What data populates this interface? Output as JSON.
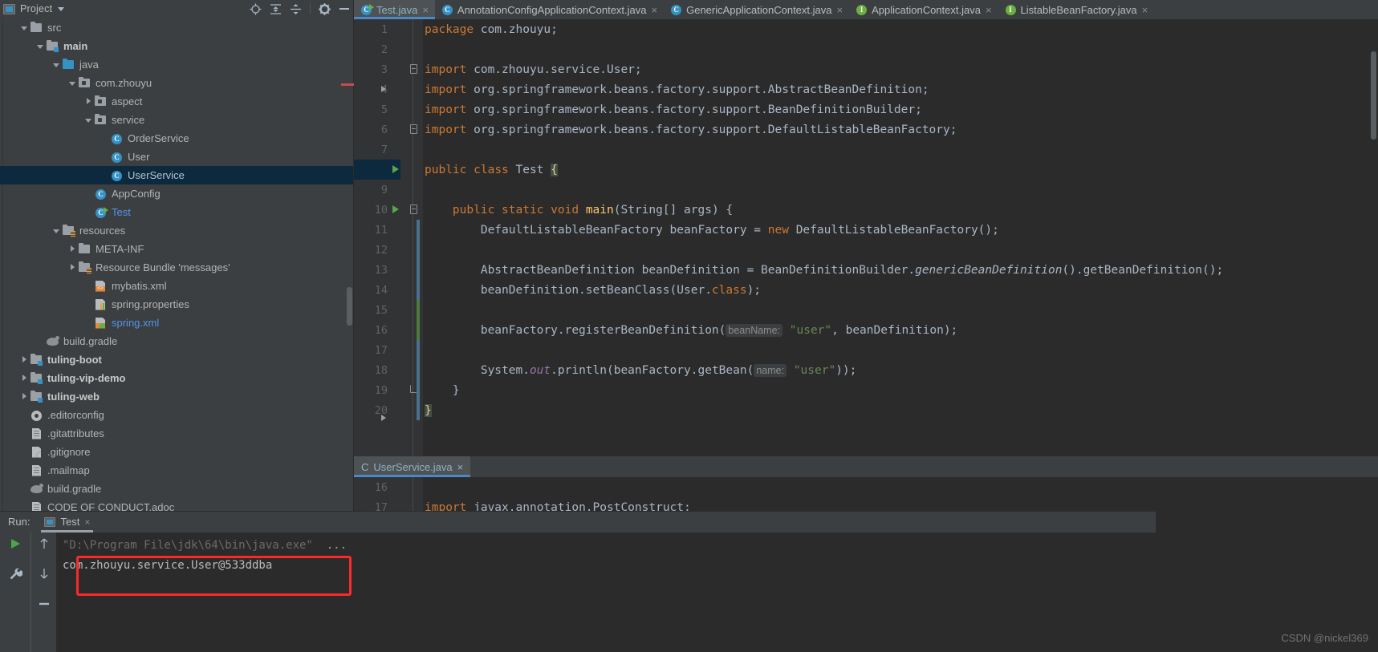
{
  "sidebar": {
    "title": "Project",
    "icons": [
      "locate-icon",
      "expand-all-icon",
      "collapse-all-icon",
      "gear-icon",
      "minimize-icon"
    ],
    "tree": [
      {
        "label": "src",
        "indent": 1,
        "arrow": "open",
        "icon": "folder-grey",
        "style": "plain"
      },
      {
        "label": "main",
        "indent": 2,
        "arrow": "open",
        "icon": "folder-module",
        "style": "bold"
      },
      {
        "label": "java",
        "indent": 3,
        "arrow": "open",
        "icon": "folder-blue",
        "style": "plain"
      },
      {
        "label": "com.zhouyu",
        "indent": 4,
        "arrow": "open",
        "icon": "folder-pkg",
        "style": "plain"
      },
      {
        "label": "aspect",
        "indent": 5,
        "arrow": "closed",
        "icon": "folder-pkg",
        "style": "plain"
      },
      {
        "label": "service",
        "indent": 5,
        "arrow": "open",
        "icon": "folder-pkg",
        "style": "plain"
      },
      {
        "label": "OrderService",
        "indent": 6,
        "arrow": "none",
        "icon": "class-icon",
        "style": "plain"
      },
      {
        "label": "User",
        "indent": 6,
        "arrow": "none",
        "icon": "class-icon",
        "style": "plain"
      },
      {
        "label": "UserService",
        "indent": 6,
        "arrow": "none",
        "icon": "class-icon",
        "style": "selected"
      },
      {
        "label": "AppConfig",
        "indent": 5,
        "arrow": "none",
        "icon": "class-icon",
        "style": "plain"
      },
      {
        "label": "Test",
        "indent": 5,
        "arrow": "none",
        "icon": "class-runnable",
        "style": "blue"
      },
      {
        "label": "resources",
        "indent": 3,
        "arrow": "open",
        "icon": "folder-res",
        "style": "plain"
      },
      {
        "label": "META-INF",
        "indent": 4,
        "arrow": "closed",
        "icon": "folder-grey",
        "style": "plain"
      },
      {
        "label": "Resource Bundle 'messages'",
        "indent": 4,
        "arrow": "closed",
        "icon": "folder-bundle",
        "style": "plain"
      },
      {
        "label": "mybatis.xml",
        "indent": 5,
        "arrow": "none",
        "icon": "xml-file",
        "style": "plain"
      },
      {
        "label": "spring.properties",
        "indent": 5,
        "arrow": "none",
        "icon": "properties-file",
        "style": "plain"
      },
      {
        "label": "spring.xml",
        "indent": 5,
        "arrow": "none",
        "icon": "spring-xml-file",
        "style": "blue"
      },
      {
        "label": "build.gradle",
        "indent": 2,
        "arrow": "none",
        "icon": "gradle-file",
        "style": "plain"
      },
      {
        "label": "tuling-boot",
        "indent": 1,
        "arrow": "closed",
        "icon": "folder-module",
        "style": "bold"
      },
      {
        "label": "tuling-vip-demo",
        "indent": 1,
        "arrow": "closed",
        "icon": "folder-module",
        "style": "bold"
      },
      {
        "label": "tuling-web",
        "indent": 1,
        "arrow": "closed",
        "icon": "folder-module",
        "style": "bold"
      },
      {
        "label": ".editorconfig",
        "indent": 1,
        "arrow": "none",
        "icon": "gear-file",
        "style": "plain"
      },
      {
        "label": ".gitattributes",
        "indent": 1,
        "arrow": "none",
        "icon": "doc-file",
        "style": "plain"
      },
      {
        "label": ".gitignore",
        "indent": 1,
        "arrow": "none",
        "icon": "gitignore-file",
        "style": "plain"
      },
      {
        "label": ".mailmap",
        "indent": 1,
        "arrow": "none",
        "icon": "doc-file",
        "style": "plain"
      },
      {
        "label": "build.gradle",
        "indent": 1,
        "arrow": "none",
        "icon": "gradle-file",
        "style": "plain"
      },
      {
        "label": "CODE OF CONDUCT.adoc",
        "indent": 1,
        "arrow": "none",
        "icon": "doc-file",
        "style": "plain"
      }
    ]
  },
  "editor": {
    "tabs": [
      {
        "label": "Test.java",
        "icon": "class-runnable-icon",
        "active": true,
        "close": "×"
      },
      {
        "label": "AnnotationConfigApplicationContext.java",
        "icon": "class-icon",
        "active": false,
        "close": "×"
      },
      {
        "label": "GenericApplicationContext.java",
        "icon": "class-icon",
        "active": false,
        "close": "×"
      },
      {
        "label": "ApplicationContext.java",
        "icon": "interface-icon",
        "active": false,
        "close": "×"
      },
      {
        "label": "ListableBeanFactory.java",
        "icon": "interface-icon",
        "active": false,
        "close": "×"
      }
    ],
    "lines": [
      {
        "n": "1",
        "html": "<span class=\"kw\">package</span> com.zhouyu;"
      },
      {
        "n": "2",
        "html": ""
      },
      {
        "n": "3",
        "html": "<span class=\"kw\">import</span> com.zhouyu.service.User;"
      },
      {
        "n": "4",
        "html": "<span class=\"kw\">import</span> org.springframework.beans.factory.support.AbstractBeanDefinition;"
      },
      {
        "n": "5",
        "html": "<span class=\"kw\">import</span> org.springframework.beans.factory.support.BeanDefinitionBuilder;"
      },
      {
        "n": "6",
        "html": "<span class=\"kw\">import</span> org.springframework.beans.factory.support.DefaultListableBeanFactory;"
      },
      {
        "n": "7",
        "html": ""
      },
      {
        "n": "8",
        "html": "<span class=\"kw\">public</span> <span class=\"kw\">class</span> Test <span class=\"brace-hl\">{</span>"
      },
      {
        "n": "9",
        "html": ""
      },
      {
        "n": "10",
        "html": "    <span class=\"kw\">public</span> <span class=\"kw\">static</span> <span class=\"kw\">void</span> <span class=\"mtd\">main</span>(String[] args) {"
      },
      {
        "n": "11",
        "html": "        DefaultListableBeanFactory beanFactory = <span class=\"kw\">new</span> DefaultListableBeanFactory();"
      },
      {
        "n": "12",
        "html": ""
      },
      {
        "n": "13",
        "html": "        AbstractBeanDefinition beanDefinition = BeanDefinitionBuilder.<span class=\"ital\">genericBeanDefinition</span>().getBeanDefinition();"
      },
      {
        "n": "14",
        "html": "        beanDefinition.setBeanClass(User.<span class=\"kw\">class</span>);"
      },
      {
        "n": "15",
        "html": ""
      },
      {
        "n": "16",
        "html": "        beanFactory.registerBeanDefinition(<span class=\"hintp\">beanName:</span> <span class=\"str\">\"user\"</span>, beanDefinition);"
      },
      {
        "n": "17",
        "html": ""
      },
      {
        "n": "18",
        "html": "        System.<span class=\"stat\">out</span>.println(beanFactory.getBean(<span class=\"hintp\">name:</span> <span class=\"str\">\"user\"</span>));"
      },
      {
        "n": "19",
        "html": "    }"
      },
      {
        "n": "20",
        "html": "<span class=\"brace-hl\">}</span>"
      }
    ]
  },
  "split_editor": {
    "tab": {
      "label": "UserService.java",
      "icon": "class-icon",
      "close": "×"
    },
    "lines": [
      {
        "n": "16",
        "html": ""
      },
      {
        "n": "17",
        "html": "<span class=\"kw\">import</span> javax.annotation.PostConstruct;"
      }
    ]
  },
  "run_panel": {
    "label": "Run:",
    "tab": {
      "label": "Test",
      "close": "×"
    },
    "side_icons": [
      "run-icon",
      "wrench-icon"
    ],
    "nav_icons": [
      "arrow-up-icon",
      "arrow-down-icon",
      "minus-icon"
    ],
    "console_lines": [
      {
        "text": "\"D:\\Program File\\jdk\\64\\bin\\java.exe\"",
        "dim": true,
        "suffix": "..."
      },
      {
        "text": "com.zhouyu.service.User@533ddba",
        "dim": false,
        "suffix": ""
      }
    ],
    "highlight_color": "#fa2a2a"
  },
  "watermark": {
    "text": "CSDN @nickel369"
  }
}
